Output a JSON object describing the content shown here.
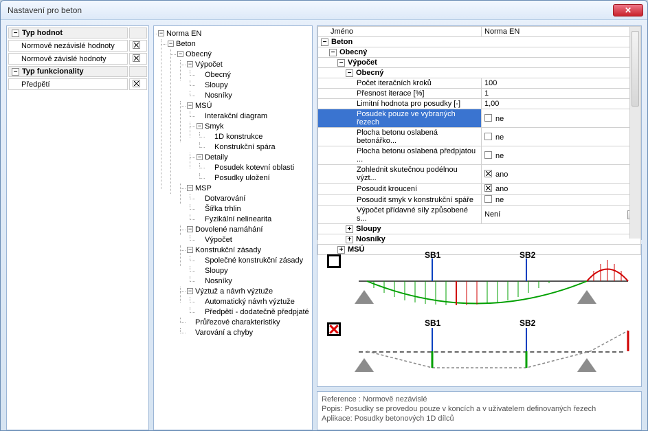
{
  "window": {
    "title": "Nastavení pro beton"
  },
  "left": {
    "section1_title": "Typ hodnot",
    "row1": "Normově nezávislé hodnoty",
    "row2": "Normově závislé hodnoty",
    "section2_title": "Typ funkcionality",
    "row3": "Předpětí"
  },
  "tree": {
    "root": "Norma EN",
    "beton": "Beton",
    "obecny": "Obecný",
    "vypocet": "Výpočet",
    "v_obecny": "Obecný",
    "v_sloupy": "Sloupy",
    "v_nosniky": "Nosníky",
    "msu": "MSÚ",
    "inter": "Interakční diagram",
    "smyk": "Smyk",
    "s1d": "1D konstrukce",
    "sspara": "Konstrukční spára",
    "detaily": "Detaily",
    "kotev": "Posudek kotevní oblasti",
    "uloz": "Posudky uložení",
    "msp": "MSP",
    "dotv": "Dotvarování",
    "trhlin": "Šířka trhlin",
    "fyz": "Fyzikální nelinearita",
    "dovol": "Dovolené namáhání",
    "dv_vyp": "Výpočet",
    "kz": "Konstrukční zásady",
    "kz_spol": "Společné konstrukční zásady",
    "kz_sloupy": "Sloupy",
    "kz_nos": "Nosníky",
    "vnv": "Výztuž a návrh výztuže",
    "vnv_auto": "Automatický návrh výztuže",
    "vnv_pred": "Předpětí - dodatečně předpjaté",
    "prur": "Průřezové charakteristiky",
    "varchyby": "Varování a chyby"
  },
  "prop": {
    "name_lbl": "Jméno",
    "name_val": "Norma EN",
    "beton": "Beton",
    "obecny": "Obecný",
    "vypocet": "Výpočet",
    "obecny2": "Obecný",
    "r1l": "Počet iteračních kroků",
    "r1v": "100",
    "r2l": "Přesnost iterace [%]",
    "r2v": "1",
    "r3l": "Limitní hodnota pro posudky [-]",
    "r3v": "1,00",
    "r4l": "Posudek pouze ve vybraných řezech",
    "r4v": "ne",
    "r5l": "Plocha betonu oslabená betonářko...",
    "r5v": "ne",
    "r6l": "Plocha betonu oslabená předpjatou ...",
    "r6v": "ne",
    "r7l": "Zohlednit skutečnou podélnou výzt...",
    "r7v": "ano",
    "r8l": "Posoudit kroucení",
    "r8v": "ano",
    "r9l": "Posoudit smyk v konstrukční spáře",
    "r9v": "ne",
    "r10l": "Výpočet přídavné síly způsobené s...",
    "r10v": "Není",
    "sloupy": "Sloupy",
    "nosniky": "Nosníky",
    "msu": "MSÚ"
  },
  "diagram": {
    "sb1": "SB1",
    "sb2": "SB2"
  },
  "desc": {
    "ref": "Reference :  Normově nezávislé",
    "popis": "Popis:  Posudky se provedou pouze v koncích a v uživatelem definovaných řezech",
    "apl": "Aplikace:  Posudky betonových 1D dílců"
  }
}
